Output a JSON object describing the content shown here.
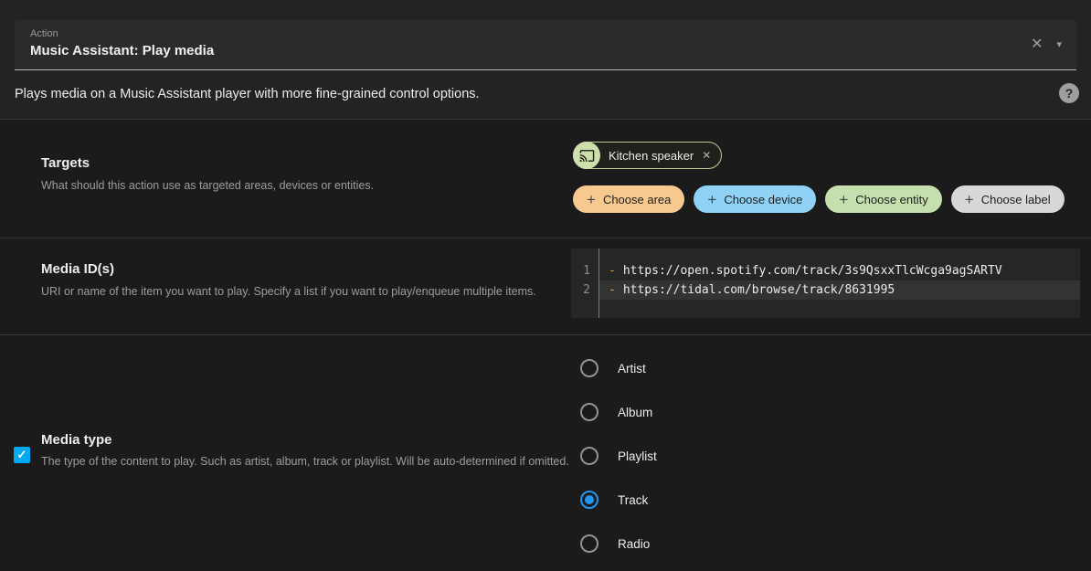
{
  "header": {
    "kind_label": "Action",
    "title": "Music Assistant: Play media",
    "close_icon": "✕",
    "expand_icon": "▾"
  },
  "summary": {
    "text": "Plays media on a Music Assistant player with more fine-grained control options.",
    "help_icon": "?"
  },
  "targets": {
    "label": "Targets",
    "description": "What should this action use as targeted areas, devices or entities.",
    "chip": {
      "label": "Kitchen speaker",
      "icon": "cast-icon",
      "remove_icon": "✕",
      "avatar_color": "#cde0ab",
      "border_color": "#b7cd92"
    },
    "buttons": [
      {
        "label": "Choose area",
        "plus_icon": "+",
        "color": "#f7c98e"
      },
      {
        "label": "Choose device",
        "plus_icon": "+",
        "color": "#8fd2f6"
      },
      {
        "label": "Choose entity",
        "plus_icon": "+",
        "color": "#c5e0ae"
      },
      {
        "label": "Choose label",
        "plus_icon": "+",
        "color": "#d8d8d8"
      }
    ]
  },
  "media_id": {
    "label": "Media ID(s)",
    "description": "URI or name of the item you want to play. Specify a list if you want to play/enqueue multiple items.",
    "editor": {
      "bullet_color": "#dba45f",
      "lines": [
        {
          "number": "1",
          "bullet": "-",
          "text": "https://open.spotify.com/track/3s9QsxxTlcWcga9agSARTV",
          "active": false
        },
        {
          "number": "2",
          "bullet": "-",
          "text": "https://tidal.com/browse/track/8631995",
          "active": true
        }
      ]
    }
  },
  "media_type": {
    "label": "Media type",
    "description": "The type of the content to play. Such as artist, album, track or playlist. Will be auto-determined if omitted.",
    "checkbox": {
      "checked": true,
      "color": "#03a9f4",
      "check_icon": "✓"
    },
    "radio_selected_color": "#2196f3",
    "options": [
      {
        "label": "Artist",
        "selected": false
      },
      {
        "label": "Album",
        "selected": false
      },
      {
        "label": "Playlist",
        "selected": false
      },
      {
        "label": "Track",
        "selected": true
      },
      {
        "label": "Radio",
        "selected": false
      }
    ]
  }
}
